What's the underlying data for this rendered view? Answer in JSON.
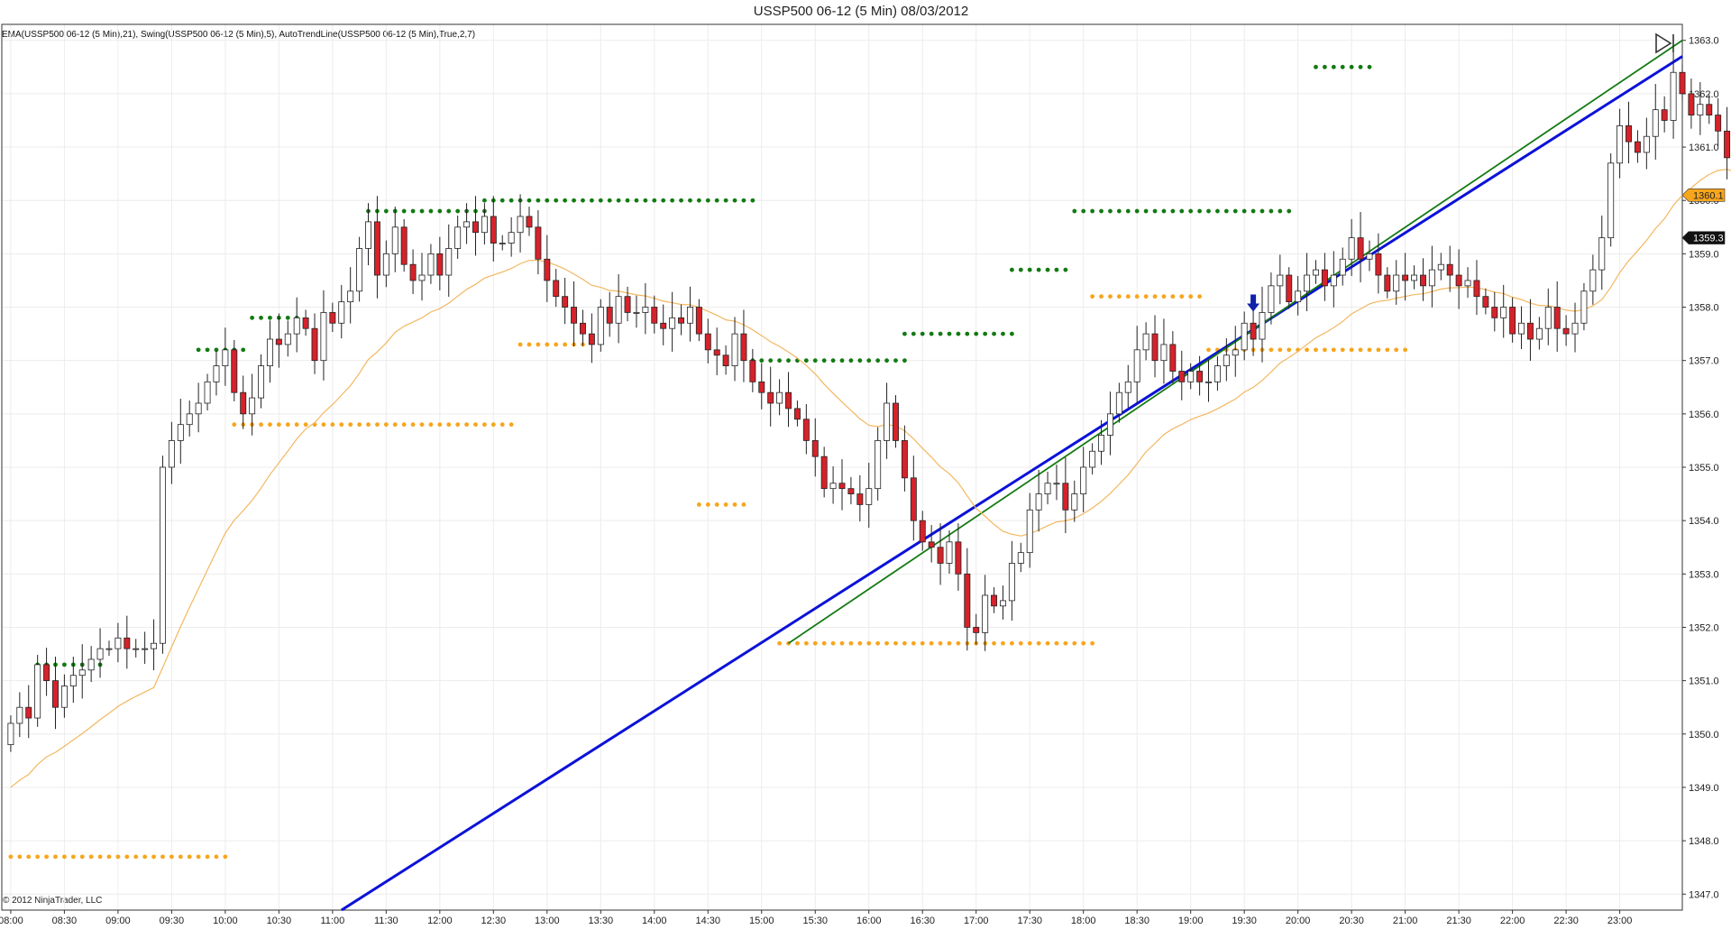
{
  "title": "USSP500 06-12 (5 Min)  08/03/2012",
  "indicators_label": "EMA(USSP500 06-12 (5 Min),21), Swing(USSP500 06-12 (5 Min),5), AutoTrendLine(USSP500 06-12 (5 Min),True,2,7)",
  "copyright": "© 2012 NinjaTrader, LLC",
  "icons": {
    "navigate": "skip-to-end-icon"
  },
  "colors": {
    "up_body": "#ffffff",
    "down_body": "#d6222a",
    "wick": "#222222",
    "ema": "#f3b760",
    "swing_high": "#127a12",
    "swing_low": "#f7a51c",
    "trend_blue": "#0c12d8",
    "trend_green": "#127a12",
    "grid": "#ececec",
    "ema_label_bg": "#f7a51c",
    "last_label_bg": "#111111",
    "signal_arrow": "#1023a8"
  },
  "chart_data": {
    "type": "candlestick",
    "x_unit": "time (HH:MM)",
    "x_range": [
      "07:55",
      "23:35"
    ],
    "y_range": [
      1346.7,
      1363.3
    ],
    "grid": true,
    "x_ticks": [
      "08:00",
      "08:30",
      "09:00",
      "09:30",
      "10:00",
      "10:30",
      "11:00",
      "11:30",
      "12:00",
      "12:30",
      "13:00",
      "13:30",
      "14:00",
      "14:30",
      "15:00",
      "15:30",
      "16:00",
      "16:30",
      "17:00",
      "17:30",
      "18:00",
      "18:30",
      "19:00",
      "19:30",
      "20:00",
      "20:30",
      "21:00",
      "21:30",
      "22:00",
      "22:30",
      "23:00"
    ],
    "y_ticks": [
      "1347.0",
      "1348.0",
      "1349.0",
      "1350.0",
      "1351.0",
      "1352.0",
      "1353.0",
      "1354.0",
      "1355.0",
      "1356.0",
      "1357.0",
      "1358.0",
      "1359.0",
      "1360.0",
      "1361.0",
      "1362.0",
      "1363.0"
    ],
    "candles_start": "08:00",
    "candle_minutes": 5,
    "closes": [
      1350.2,
      1350.5,
      1350.3,
      1351.3,
      1351.0,
      1350.5,
      1350.9,
      1351.1,
      1351.2,
      1351.4,
      1351.6,
      1351.6,
      1351.8,
      1351.6,
      1351.6,
      1351.6,
      1351.7,
      1355.0,
      1355.5,
      1355.8,
      1356.0,
      1356.2,
      1356.6,
      1356.9,
      1357.2,
      1356.4,
      1356.0,
      1356.3,
      1356.9,
      1357.4,
      1357.3,
      1357.5,
      1357.8,
      1357.6,
      1357.0,
      1357.9,
      1357.7,
      1358.1,
      1358.3,
      1359.1,
      1359.6,
      1358.6,
      1359.0,
      1359.5,
      1358.8,
      1358.5,
      1358.6,
      1359.0,
      1358.6,
      1359.1,
      1359.5,
      1359.6,
      1359.4,
      1359.7,
      1359.2,
      1359.2,
      1359.4,
      1359.7,
      1359.5,
      1358.9,
      1358.5,
      1358.2,
      1358.0,
      1357.7,
      1357.5,
      1357.3,
      1358.0,
      1357.7,
      1358.2,
      1357.9,
      1357.9,
      1358.0,
      1357.7,
      1357.6,
      1357.8,
      1357.7,
      1358.0,
      1357.5,
      1357.2,
      1357.1,
      1356.9,
      1357.5,
      1357.0,
      1356.6,
      1356.4,
      1356.2,
      1356.4,
      1356.1,
      1355.9,
      1355.5,
      1355.2,
      1354.6,
      1354.7,
      1354.6,
      1354.5,
      1354.3,
      1354.6,
      1355.5,
      1356.2,
      1355.5,
      1354.8,
      1354.0,
      1353.6,
      1353.5,
      1353.2,
      1353.6,
      1353.0,
      1352.0,
      1351.9,
      1352.6,
      1352.4,
      1352.5,
      1353.2,
      1353.4,
      1354.2,
      1354.5,
      1354.7,
      1354.7,
      1354.2,
      1354.5,
      1355.0,
      1355.3,
      1355.6,
      1356.0,
      1356.4,
      1356.6,
      1357.2,
      1357.5,
      1357.0,
      1357.3,
      1356.8,
      1356.6,
      1356.8,
      1356.6,
      1356.6,
      1356.9,
      1357.1,
      1357.2,
      1357.7,
      1357.4,
      1357.9,
      1358.4,
      1358.6,
      1358.1,
      1358.3,
      1358.6,
      1358.7,
      1358.4,
      1358.6,
      1358.9,
      1359.3,
      1358.9,
      1359.0,
      1358.6,
      1358.3,
      1358.6,
      1358.5,
      1358.6,
      1358.4,
      1358.7,
      1358.8,
      1358.6,
      1358.4,
      1358.5,
      1358.2,
      1358.0,
      1357.8,
      1358.0,
      1357.5,
      1357.7,
      1357.4,
      1357.6,
      1358.0,
      1357.6,
      1357.5,
      1357.7,
      1358.3,
      1358.7,
      1359.3,
      1360.7,
      1361.4,
      1361.1,
      1360.9,
      1361.2,
      1361.7,
      1361.5,
      1362.4,
      1362.0,
      1361.6,
      1361.8,
      1361.6,
      1361.3,
      1360.8,
      1360.0,
      1360.5,
      1360.0,
      1360.7,
      1360.0,
      1359.5,
      1359.3
    ],
    "ema_period": 21,
    "swing_strength": 5,
    "swing_highs": [
      {
        "from": "08:15",
        "to": "08:50",
        "value": 1351.3
      },
      {
        "from": "09:45",
        "to": "10:10",
        "value": 1357.2
      },
      {
        "from": "10:15",
        "to": "10:40",
        "value": 1357.8
      },
      {
        "from": "11:20",
        "to": "12:25",
        "value": 1359.8
      },
      {
        "from": "12:25",
        "to": "14:55",
        "value": 1360.0
      },
      {
        "from": "14:55",
        "to": "16:20",
        "value": 1357.0
      },
      {
        "from": "16:20",
        "to": "17:20",
        "value": 1357.5
      },
      {
        "from": "17:20",
        "to": "17:50",
        "value": 1358.7
      },
      {
        "from": "17:55",
        "to": "19:55",
        "value": 1359.8
      },
      {
        "from": "20:10",
        "to": "20:40",
        "value": 1362.5
      }
    ],
    "swing_lows": [
      {
        "from": "08:00",
        "to": "10:00",
        "value": 1347.7
      },
      {
        "from": "10:05",
        "to": "12:40",
        "value": 1355.8
      },
      {
        "from": "12:45",
        "to": "13:20",
        "value": 1357.3
      },
      {
        "from": "14:25",
        "to": "14:50",
        "value": 1354.3
      },
      {
        "from": "15:10",
        "to": "18:05",
        "value": 1351.7
      },
      {
        "from": "18:05",
        "to": "19:05",
        "value": 1358.2
      },
      {
        "from": "19:10",
        "to": "21:00",
        "value": 1357.2
      }
    ],
    "trend_lines": [
      {
        "name": "blue",
        "color": "#0c12d8",
        "from": {
          "x": "11:05",
          "y": 1346.7
        },
        "to": {
          "x": "23:35",
          "y": 1362.7
        }
      },
      {
        "name": "green",
        "color": "#127a12",
        "from": {
          "x": "15:15",
          "y": 1351.7
        },
        "to": {
          "x": "23:35",
          "y": 1363.0
        }
      }
    ],
    "signal_arrow": {
      "x": "19:35",
      "y": 1357.9,
      "direction": "down"
    },
    "price_labels": {
      "ema": "1360.1",
      "last": "1359.3"
    }
  }
}
